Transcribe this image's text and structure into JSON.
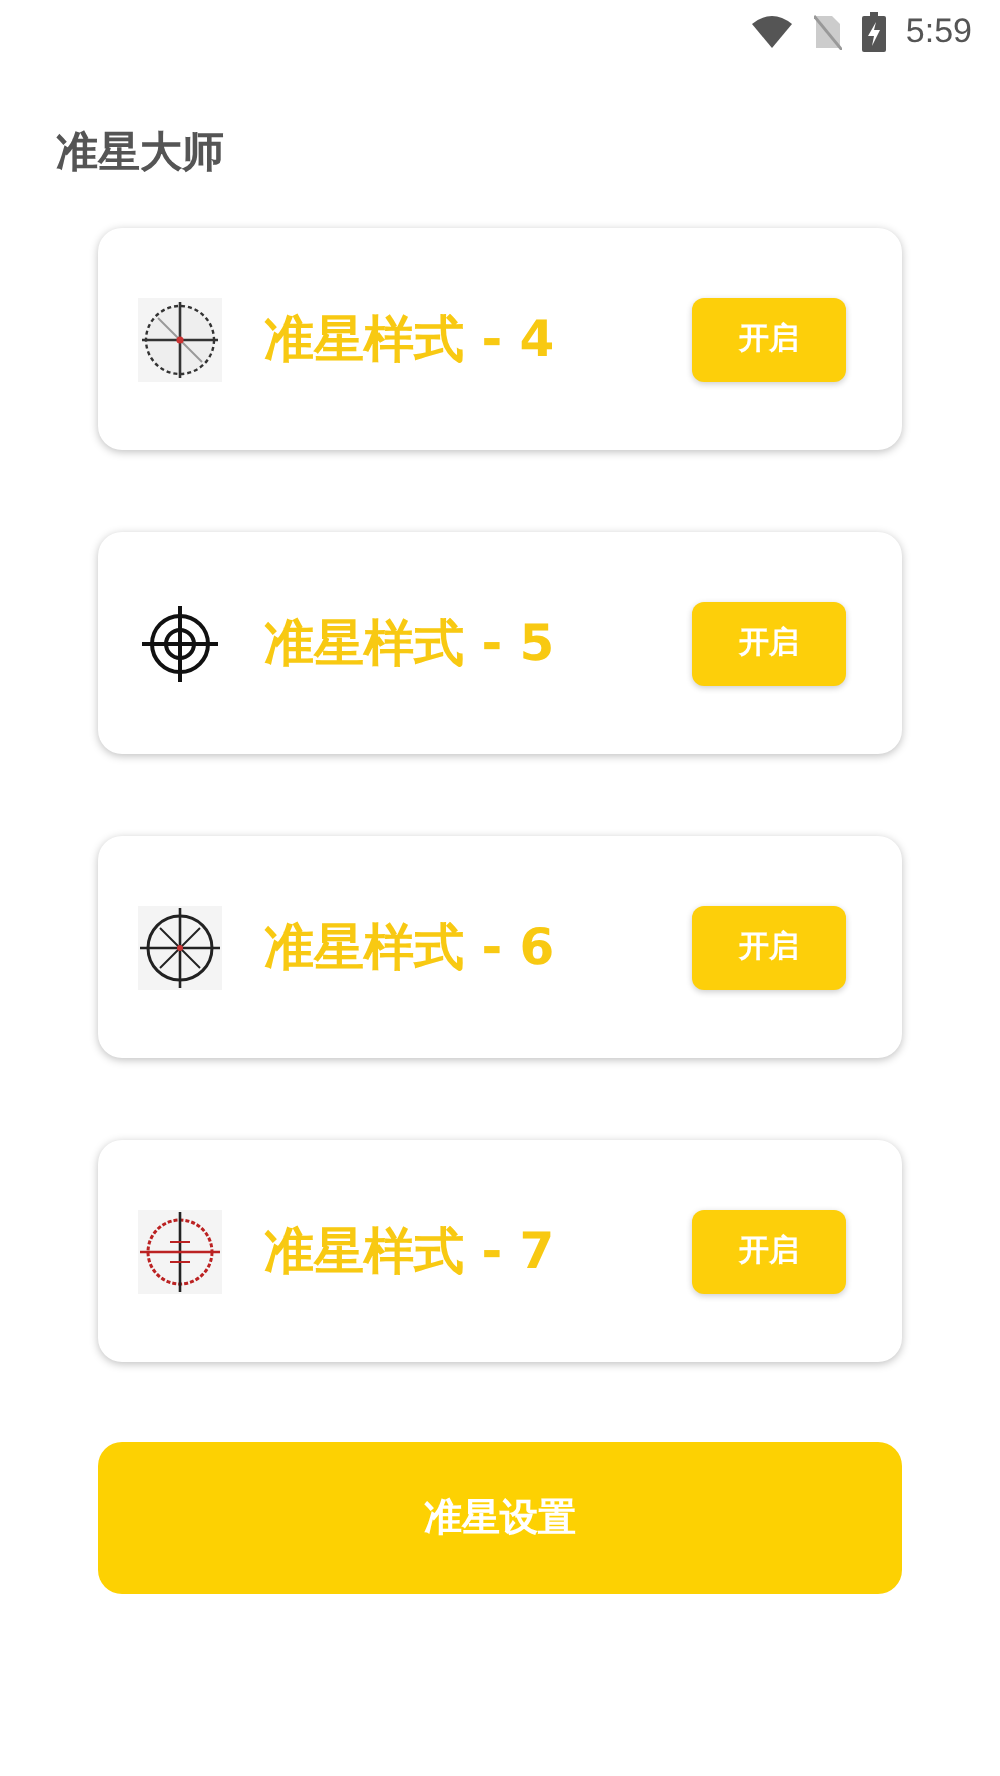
{
  "status_bar": {
    "time": "5:59"
  },
  "title": "准星大师",
  "styles": [
    {
      "name": "准星样式 - 4",
      "kind": "dashed",
      "button": "开启"
    },
    {
      "name": "准星样式 - 5",
      "kind": "ring",
      "button": "开启"
    },
    {
      "name": "准星样式 - 6",
      "kind": "spoked",
      "button": "开启"
    },
    {
      "name": "准星样式 - 7",
      "kind": "red",
      "button": "开启"
    }
  ],
  "settings_button": "准星设置"
}
